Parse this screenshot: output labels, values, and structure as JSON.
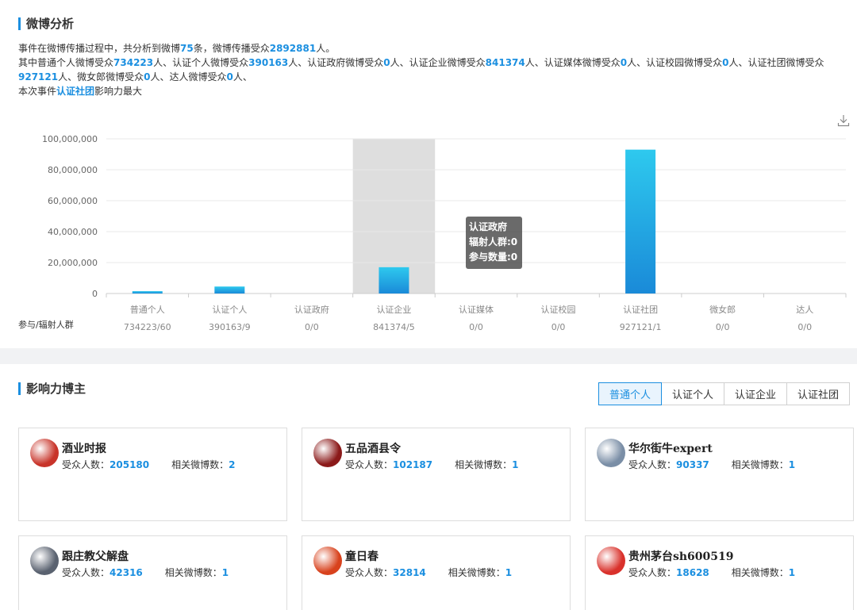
{
  "analysis": {
    "title": "微博分析",
    "line1": {
      "pre": "事件在微博传播过程中，共分析到微博",
      "count": "75",
      "mid": "条，微博传播受众",
      "audience": "2892881",
      "post": "人。"
    },
    "line2": [
      {
        "t": "其中普通个人微博受众",
        "h": false
      },
      {
        "t": "734223",
        "h": true
      },
      {
        "t": "人、认证个人微博受众",
        "h": false
      },
      {
        "t": "390163",
        "h": true
      },
      {
        "t": "人、认证政府微博受众",
        "h": false
      },
      {
        "t": "0",
        "h": true
      },
      {
        "t": "人、认证企业微博受众",
        "h": false
      },
      {
        "t": "841374",
        "h": true
      },
      {
        "t": "人、认证媒体微博受众",
        "h": false
      },
      {
        "t": "0",
        "h": true
      },
      {
        "t": "人、认证校园微博受众",
        "h": false
      },
      {
        "t": "0",
        "h": true
      },
      {
        "t": "人、认证社团微博受众",
        "h": false
      },
      {
        "t": "927121",
        "h": true
      },
      {
        "t": "人、微女郎微博受众",
        "h": false
      },
      {
        "t": "0",
        "h": true
      },
      {
        "t": "人、达人微博受众",
        "h": false
      },
      {
        "t": "0",
        "h": true
      },
      {
        "t": "人、",
        "h": false
      }
    ],
    "line3": {
      "pre": "本次事件",
      "highlight": "认证社团",
      "post": "影响力最大"
    },
    "download_icon": "download-icon"
  },
  "chart_data": {
    "type": "bar",
    "categories": [
      "普通个人",
      "认证个人",
      "认证政府",
      "认证企业",
      "认证媒体",
      "认证校园",
      "认证社团",
      "微女郎",
      "达人"
    ],
    "values": [
      1500000,
      4500000,
      0,
      17000000,
      0,
      0,
      93000000,
      0,
      0
    ],
    "yticks": [
      "0",
      "20,000,000",
      "40,000,000",
      "60,000,000",
      "80,000,000",
      "100,000,000"
    ],
    "ylim": [
      0,
      100000000
    ],
    "row_label": "参与/辐射人群",
    "row_values": [
      "734223/60",
      "390163/9",
      "0/0",
      "841374/5",
      "0/0",
      "0/0",
      "927121/1",
      "0/0",
      "0/0"
    ],
    "highlighted_category_index": 3,
    "bar_color_top": "#2ec9ee",
    "bar_color_bottom": "#1a8ad8",
    "tooltip": {
      "title": "认证政府",
      "line1": "辐射人群:0",
      "line2": "参与数量:0"
    }
  },
  "influencers": {
    "title": "影响力博主",
    "tabs": [
      "普通个人",
      "认证个人",
      "认证企业",
      "认证社团"
    ],
    "active_tab": 0,
    "audience_label": "受众人数：",
    "posts_label": "相关微博数：",
    "cards": [
      {
        "name": "酒业时报",
        "audience": "205180",
        "posts": "2",
        "avatar_color": "#c8342a"
      },
      {
        "name": "五品酒县令",
        "audience": "102187",
        "posts": "1",
        "avatar_color": "#8b1a1a"
      },
      {
        "name": "华尔街牛expert",
        "audience": "90337",
        "posts": "1",
        "avatar_color": "#7a8ea6"
      },
      {
        "name": "跟庄教父解盘",
        "audience": "42316",
        "posts": "1",
        "avatar_color": "#5a6270"
      },
      {
        "name": "童日春",
        "audience": "32814",
        "posts": "1",
        "avatar_color": "#d8421d"
      },
      {
        "name": "贵州茅台sh600519",
        "audience": "18628",
        "posts": "1",
        "avatar_color": "#d9312b"
      }
    ]
  },
  "colors": {
    "accent": "#1b8fe0",
    "gridline": "#e8e8e8",
    "highlight_band": "#dedede"
  }
}
